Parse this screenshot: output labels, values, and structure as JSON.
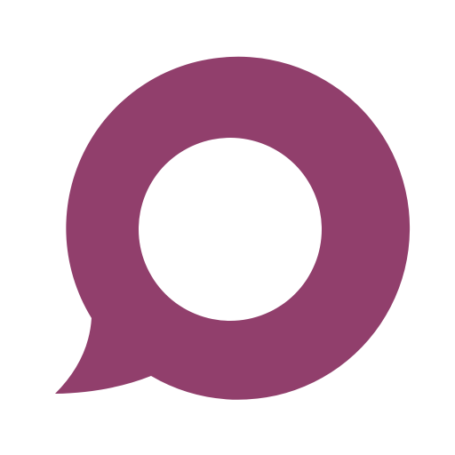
{
  "logo": {
    "icon": "speech-bubble-ring-icon",
    "color": "#913f6c",
    "background": "#ffffff"
  }
}
